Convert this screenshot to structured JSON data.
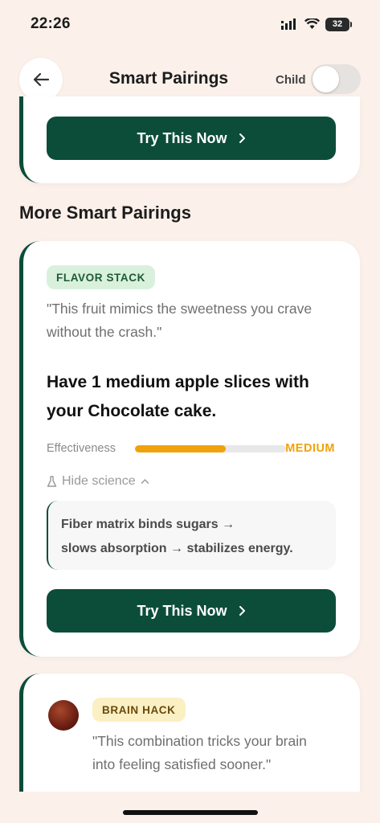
{
  "status_bar": {
    "time": "22:26",
    "battery": "32"
  },
  "header": {
    "title": "Smart Pairings",
    "child_label": "Child",
    "child_enabled": false
  },
  "top_card": {
    "button_label": "Try This Now"
  },
  "section": {
    "heading": "More Smart Pairings"
  },
  "main_card": {
    "badge": "FLAVOR STACK",
    "quote_line1": "\"This fruit mimics the sweetness you crave",
    "quote_line2": "without the crash.\"",
    "headline_line1": "Have 1 medium apple slices with",
    "headline_line2": "your Chocolate cake.",
    "effectiveness_label": "Effectiveness",
    "effectiveness_level": "MEDIUM",
    "effectiveness_fraction": 0.6,
    "hide_science_label": "Hide science",
    "science_line1": "Fiber matrix binds sugars",
    "science_line2a": "slows absorption",
    "science_line2b": "stabilizes energy.",
    "button_label": "Try This Now"
  },
  "bottom_card": {
    "badge": "BRAIN HACK",
    "quote_line1": "\"This combination tricks your brain",
    "quote_line2": "into feeling satisfied sooner.\""
  },
  "colors": {
    "background": "#fbf0ea",
    "primary": "#0c4d3a",
    "medium": "#f0a20c",
    "flavor_badge_bg": "#d9f0dd",
    "brain_badge_bg": "#fbefc4"
  },
  "icons": [
    "signal-icon",
    "wifi-icon",
    "battery-icon",
    "back-arrow-icon",
    "chevron-right-icon",
    "flask-icon",
    "chevron-up-icon",
    "arrow-right-icon"
  ]
}
